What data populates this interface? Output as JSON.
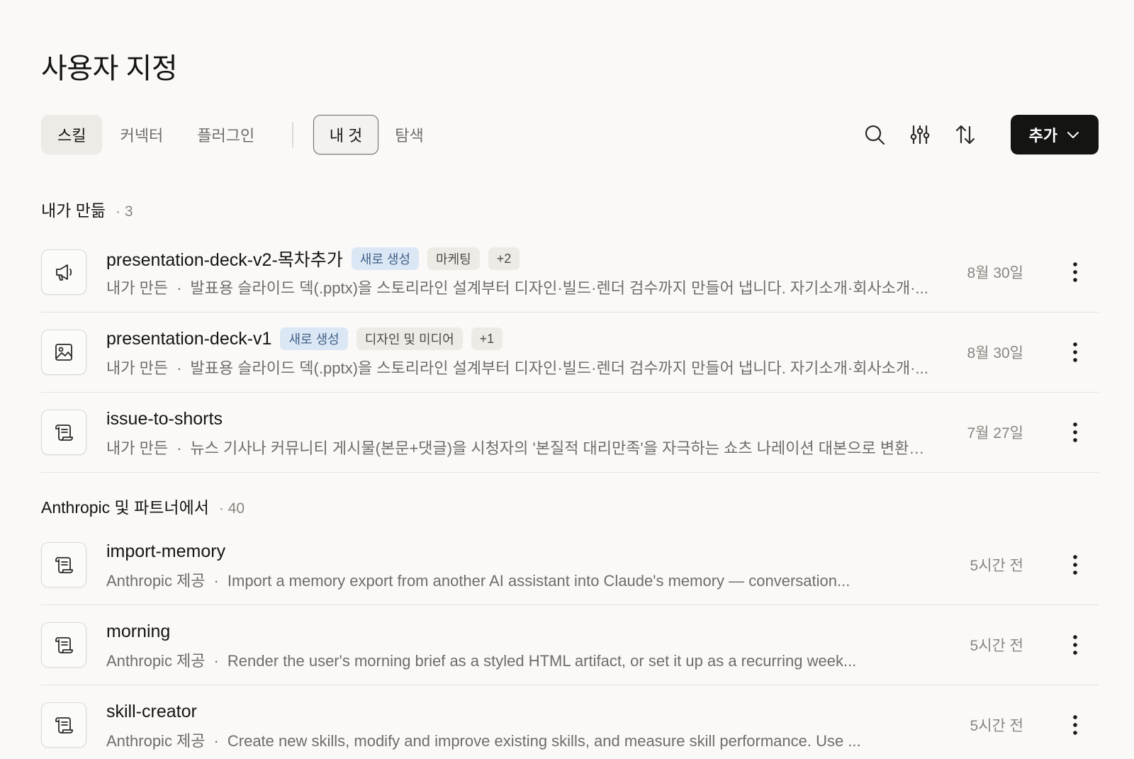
{
  "page": {
    "title": "사용자 지정"
  },
  "tabs": {
    "primary": [
      {
        "label": "스킬",
        "active": true
      },
      {
        "label": "커넥터",
        "active": false
      },
      {
        "label": "플러그인",
        "active": false
      }
    ],
    "secondary": [
      {
        "label": "내 것",
        "active": true
      },
      {
        "label": "탐색",
        "active": false
      }
    ]
  },
  "toolbar": {
    "icons": [
      "search-icon",
      "filter-sliders-icon",
      "sort-icon"
    ],
    "add_label": "추가"
  },
  "sections": [
    {
      "title": "내가 만듦",
      "count": "· 3",
      "items": [
        {
          "icon": "megaphone-icon",
          "title": "presentation-deck-v2-목차추가",
          "badges": [
            {
              "label": "새로 생성",
              "kind": "new"
            },
            {
              "label": "마케팅",
              "kind": "tag"
            },
            {
              "label": "+2",
              "kind": "tag"
            }
          ],
          "source": "내가 만든",
          "sep": "·",
          "description": "발표용 슬라이드 덱(.pptx)을 스토리라인 설계부터 디자인·빌드·렌더 검수까지 만들어 냅니다. 자기소개·회사소개·...",
          "date": "8월 30일"
        },
        {
          "icon": "image-icon",
          "title": "presentation-deck-v1",
          "badges": [
            {
              "label": "새로 생성",
              "kind": "new"
            },
            {
              "label": "디자인 및 미디어",
              "kind": "tag"
            },
            {
              "label": "+1",
              "kind": "tag"
            }
          ],
          "source": "내가 만든",
          "sep": "·",
          "description": "발표용 슬라이드 덱(.pptx)을 스토리라인 설계부터 디자인·빌드·렌더 검수까지 만들어 냅니다. 자기소개·회사소개·...",
          "date": "8월 30일"
        },
        {
          "icon": "scroll-icon",
          "title": "issue-to-shorts",
          "badges": [],
          "source": "내가 만든",
          "sep": "·",
          "description": "뉴스 기사나 커뮤니티 게시물(본문+댓글)을 시청자의 '본질적 대리만족'을 자극하는 쇼츠 나레이션 대본으로 변환하...",
          "date": "7월 27일"
        }
      ]
    },
    {
      "title": "Anthropic 및 파트너에서",
      "count": "· 40",
      "items": [
        {
          "icon": "scroll-icon",
          "title": "import-memory",
          "badges": [],
          "source": "Anthropic 제공",
          "sep": "·",
          "description": "Import a memory export from another AI assistant into Claude's memory — conversation...",
          "date": "5시간 전"
        },
        {
          "icon": "scroll-icon",
          "title": "morning",
          "badges": [],
          "source": "Anthropic 제공",
          "sep": "·",
          "description": "Render the user's morning brief as a styled HTML artifact, or set it up as a recurring week...",
          "date": "5시간 전"
        },
        {
          "icon": "scroll-icon",
          "title": "skill-creator",
          "badges": [],
          "source": "Anthropic 제공",
          "sep": "·",
          "description": "Create new skills, modify and improve existing skills, and measure skill performance. Use ...",
          "date": "5시간 전"
        }
      ]
    }
  ]
}
